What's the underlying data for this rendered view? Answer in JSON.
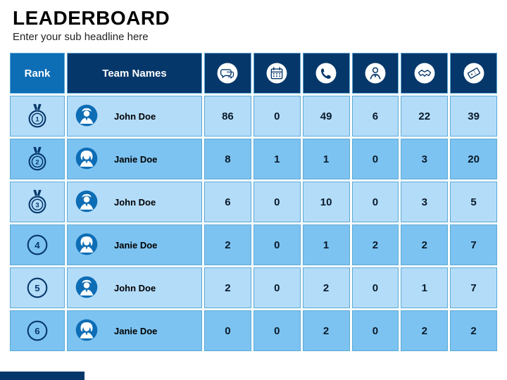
{
  "header": {
    "title": "LEADERBOARD",
    "subtitle": "Enter your sub headline here"
  },
  "columns": {
    "rank": "Rank",
    "team": "Team Names",
    "icons": [
      "chat-icon",
      "calendar-icon",
      "phone-icon",
      "person-icon",
      "handshake-icon",
      "ticket-icon"
    ]
  },
  "rows": [
    {
      "rank": 1,
      "rank_style": "medal",
      "name": "John Doe",
      "avatar": "male",
      "values": [
        86,
        0,
        49,
        6,
        22,
        39
      ]
    },
    {
      "rank": 2,
      "rank_style": "medal",
      "name": "Janie Doe",
      "avatar": "female",
      "values": [
        8,
        1,
        1,
        0,
        3,
        20
      ]
    },
    {
      "rank": 3,
      "rank_style": "medal",
      "name": "John Doe",
      "avatar": "male",
      "values": [
        6,
        0,
        10,
        0,
        3,
        5
      ]
    },
    {
      "rank": 4,
      "rank_style": "circle",
      "name": "Janie Doe",
      "avatar": "female",
      "values": [
        2,
        0,
        1,
        2,
        2,
        7
      ]
    },
    {
      "rank": 5,
      "rank_style": "circle",
      "name": "John Doe",
      "avatar": "male",
      "values": [
        2,
        0,
        2,
        0,
        1,
        7
      ]
    },
    {
      "rank": 6,
      "rank_style": "circle",
      "name": "Janie Doe",
      "avatar": "female",
      "values": [
        0,
        0,
        2,
        0,
        2,
        2
      ]
    }
  ],
  "colors": {
    "dark_blue": "#06376a",
    "mid_blue": "#0d6db5",
    "light_blue_a": "#b3dcf9",
    "light_blue_b": "#7cc3f1",
    "border": "#5ba9d6"
  }
}
